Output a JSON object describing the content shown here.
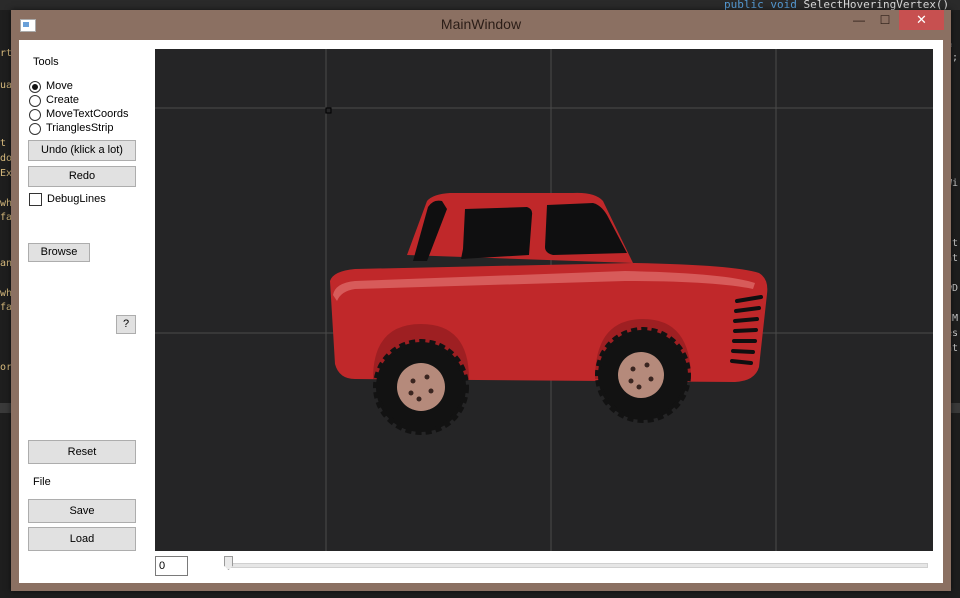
{
  "background": {
    "code_line": "public void SelectHoveringVertex()",
    "code_keywords": "public void",
    "code_name": "SelectHoveringVertex()",
    "left_fragments": [
      "rt",
      "ua",
      "t",
      "do",
      "Ex",
      "wh",
      "fa",
      "an",
      "wh",
      "fa",
      "or"
    ],
    "right_fragments": [
      "=",
      "s;",
      "Wi",
      "st",
      "at",
      "wD",
      "dM",
      "es",
      "nt"
    ]
  },
  "window": {
    "title": "MainWindow",
    "minimize_glyph": "—",
    "maximize_glyph": "☐",
    "close_glyph": "✕"
  },
  "tools": {
    "heading": "Tools",
    "options": [
      {
        "label": "Move",
        "selected": true
      },
      {
        "label": "Create",
        "selected": false
      },
      {
        "label": "MoveTextCoords",
        "selected": false
      },
      {
        "label": "TrianglesStrip",
        "selected": false
      }
    ],
    "undo_label": "Undo (klick a lot)",
    "redo_label": "Redo",
    "debug_lines_label": "DebugLines",
    "debug_lines_checked": false,
    "browse_label": "Browse",
    "help_label": "?",
    "reset_label": "Reset"
  },
  "file": {
    "heading": "File",
    "save_label": "Save",
    "load_label": "Load"
  },
  "canvas": {
    "background_color": "#252526",
    "grid_color": "#4a4a4a",
    "car_body_color": "#c0282a",
    "tire_color": "#121212",
    "hub_color": "#b58a7b"
  },
  "timeline": {
    "frame_value": "0",
    "slider_value": 0
  }
}
